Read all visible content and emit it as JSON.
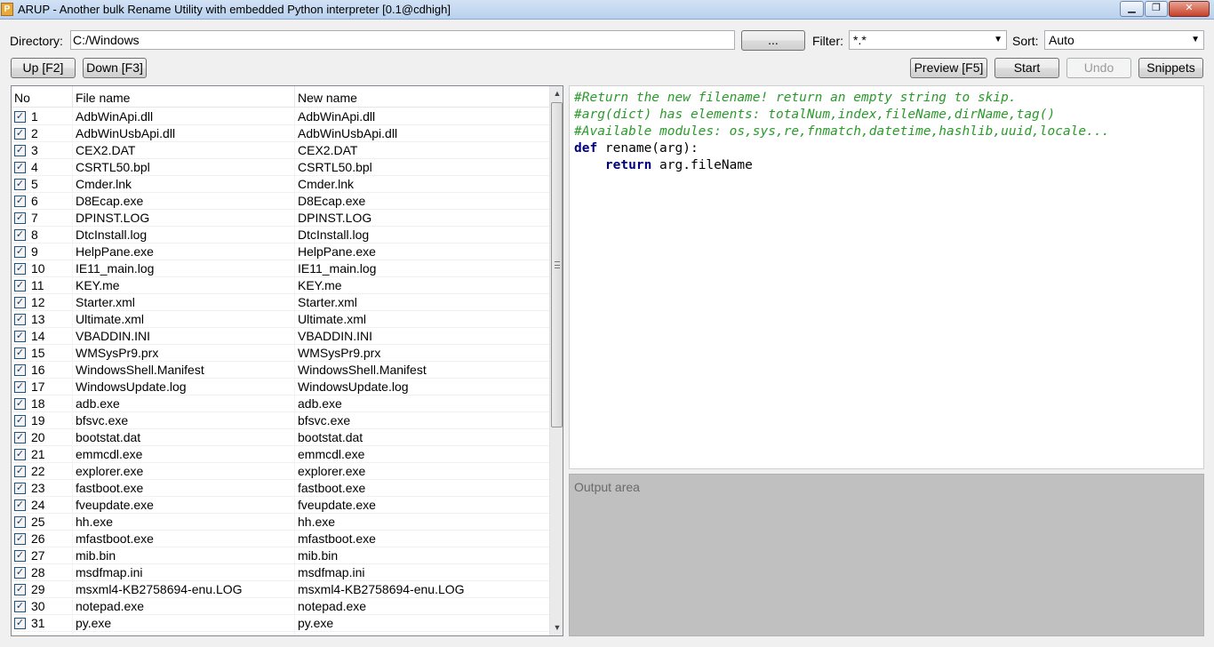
{
  "window": {
    "icon_letter": "P",
    "title": "ARUP - Another bulk Rename Utility with embedded Python interpreter [0.1@cdhigh]",
    "minimize_glyph": "▁",
    "maximize_glyph": "❐",
    "close_glyph": "✕"
  },
  "toolbar": {
    "directory_label": "Directory:",
    "directory_value": "C:/Windows",
    "browse_label": "...",
    "filter_label": "Filter:",
    "filter_value": "*.*",
    "sort_label": "Sort:",
    "sort_value": "Auto",
    "up_label": "Up [F2]",
    "down_label": "Down [F3]",
    "preview_label": "Preview [F5]",
    "start_label": "Start",
    "undo_label": "Undo",
    "snippets_label": "Snippets"
  },
  "file_list": {
    "columns": [
      "No",
      "File name",
      "New name"
    ],
    "rows": [
      {
        "no": "1",
        "file": "AdbWinApi.dll",
        "new": "AdbWinApi.dll",
        "checked": true
      },
      {
        "no": "2",
        "file": "AdbWinUsbApi.dll",
        "new": "AdbWinUsbApi.dll",
        "checked": true
      },
      {
        "no": "3",
        "file": "CEX2.DAT",
        "new": "CEX2.DAT",
        "checked": true
      },
      {
        "no": "4",
        "file": "CSRTL50.bpl",
        "new": "CSRTL50.bpl",
        "checked": true
      },
      {
        "no": "5",
        "file": "Cmder.lnk",
        "new": "Cmder.lnk",
        "checked": true
      },
      {
        "no": "6",
        "file": "D8Ecap.exe",
        "new": "D8Ecap.exe",
        "checked": true
      },
      {
        "no": "7",
        "file": "DPINST.LOG",
        "new": "DPINST.LOG",
        "checked": true
      },
      {
        "no": "8",
        "file": "DtcInstall.log",
        "new": "DtcInstall.log",
        "checked": true
      },
      {
        "no": "9",
        "file": "HelpPane.exe",
        "new": "HelpPane.exe",
        "checked": true
      },
      {
        "no": "10",
        "file": "IE11_main.log",
        "new": "IE11_main.log",
        "checked": true
      },
      {
        "no": "11",
        "file": "KEY.me",
        "new": "KEY.me",
        "checked": true
      },
      {
        "no": "12",
        "file": "Starter.xml",
        "new": "Starter.xml",
        "checked": true
      },
      {
        "no": "13",
        "file": "Ultimate.xml",
        "new": "Ultimate.xml",
        "checked": true
      },
      {
        "no": "14",
        "file": "VBADDIN.INI",
        "new": "VBADDIN.INI",
        "checked": true
      },
      {
        "no": "15",
        "file": "WMSysPr9.prx",
        "new": "WMSysPr9.prx",
        "checked": true
      },
      {
        "no": "16",
        "file": "WindowsShell.Manifest",
        "new": "WindowsShell.Manifest",
        "checked": true
      },
      {
        "no": "17",
        "file": "WindowsUpdate.log",
        "new": "WindowsUpdate.log",
        "checked": true
      },
      {
        "no": "18",
        "file": "adb.exe",
        "new": "adb.exe",
        "checked": true
      },
      {
        "no": "19",
        "file": "bfsvc.exe",
        "new": "bfsvc.exe",
        "checked": true
      },
      {
        "no": "20",
        "file": "bootstat.dat",
        "new": "bootstat.dat",
        "checked": true
      },
      {
        "no": "21",
        "file": "emmcdl.exe",
        "new": "emmcdl.exe",
        "checked": true
      },
      {
        "no": "22",
        "file": "explorer.exe",
        "new": "explorer.exe",
        "checked": true
      },
      {
        "no": "23",
        "file": "fastboot.exe",
        "new": "fastboot.exe",
        "checked": true
      },
      {
        "no": "24",
        "file": "fveupdate.exe",
        "new": "fveupdate.exe",
        "checked": true
      },
      {
        "no": "25",
        "file": "hh.exe",
        "new": "hh.exe",
        "checked": true
      },
      {
        "no": "26",
        "file": "mfastboot.exe",
        "new": "mfastboot.exe",
        "checked": true
      },
      {
        "no": "27",
        "file": "mib.bin",
        "new": "mib.bin",
        "checked": true
      },
      {
        "no": "28",
        "file": "msdfmap.ini",
        "new": "msdfmap.ini",
        "checked": true
      },
      {
        "no": "29",
        "file": "msxml4-KB2758694-enu.LOG",
        "new": "msxml4-KB2758694-enu.LOG",
        "checked": true
      },
      {
        "no": "30",
        "file": "notepad.exe",
        "new": "notepad.exe",
        "checked": true
      },
      {
        "no": "31",
        "file": "py.exe",
        "new": "py.exe",
        "checked": true
      }
    ]
  },
  "editor": {
    "lines": [
      {
        "type": "comment",
        "text": "#Return the new filename! return an empty string to skip."
      },
      {
        "type": "comment",
        "text": "#arg(dict) has elements: totalNum,index,fileName,dirName,tag()"
      },
      {
        "type": "comment",
        "text": "#Available modules: os,sys,re,fnmatch,datetime,hashlib,uuid,locale..."
      },
      {
        "type": "code",
        "kw": "def",
        "rest": " rename(arg):"
      },
      {
        "type": "code",
        "kw": "    return",
        "rest": " arg.fileName"
      }
    ]
  },
  "output": {
    "placeholder": "Output area"
  },
  "colors": {
    "comment": "#2b9a2b",
    "keyword": "#00007f",
    "output_bg": "#c0c0c0"
  }
}
